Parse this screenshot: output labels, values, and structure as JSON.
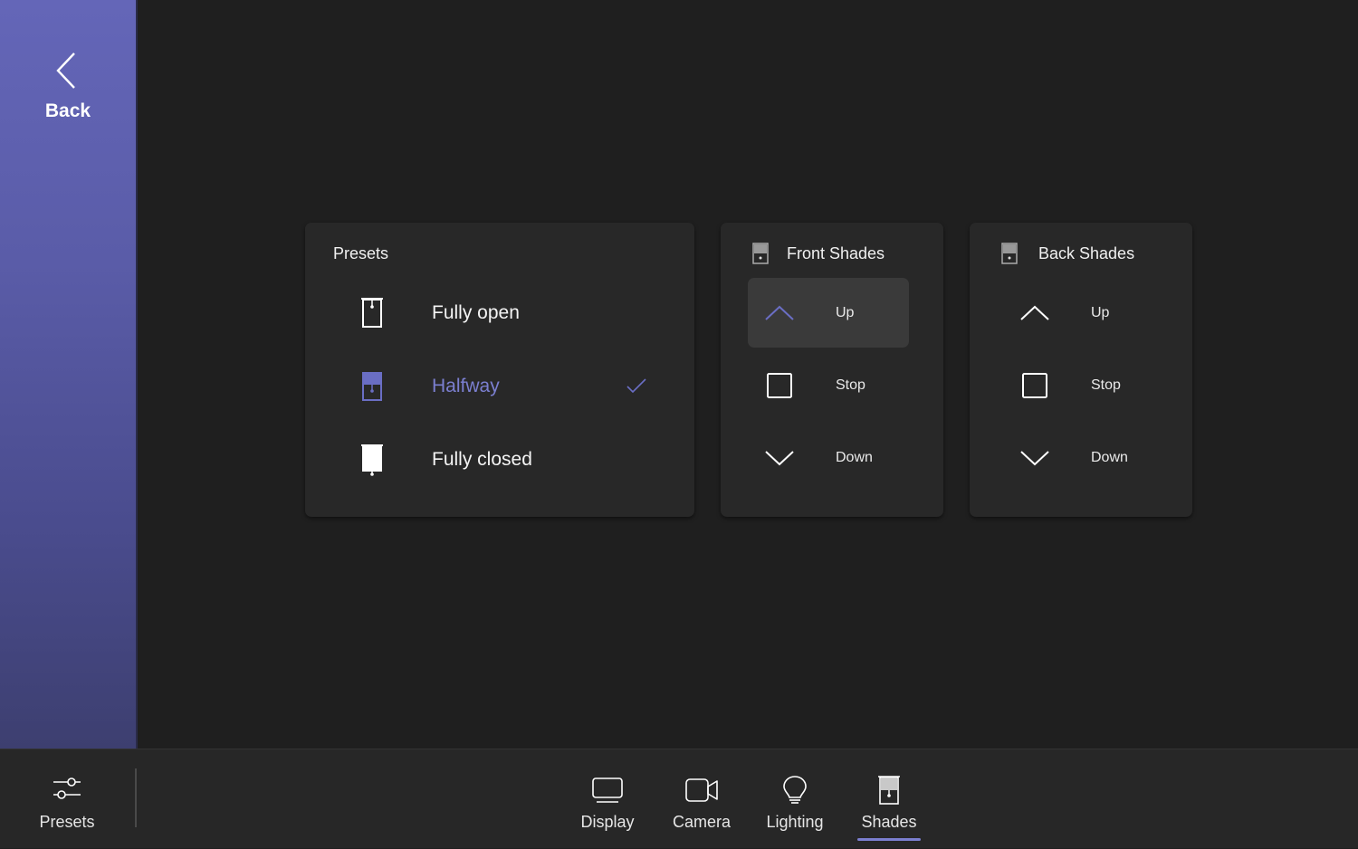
{
  "sidebar": {
    "back_label": "Back",
    "back_icon": "chevron-left-icon"
  },
  "colors": {
    "accent": "#7b7fd0",
    "sidebar_top": "#6466b8",
    "sidebar_bottom": "#3d3f70",
    "background": "#1f1f1f",
    "card": "#282828"
  },
  "presets_card": {
    "title": "Presets",
    "items": [
      {
        "label": "Fully open",
        "icon": "shade-open-icon",
        "selected": false
      },
      {
        "label": "Halfway",
        "icon": "shade-halfway-icon",
        "selected": true
      },
      {
        "label": "Fully closed",
        "icon": "shade-closed-icon",
        "selected": false
      }
    ]
  },
  "front_shades": {
    "title": "Front Shades",
    "icon": "shade-icon",
    "controls": [
      {
        "label": "Up",
        "icon": "chevron-up-icon",
        "active": true
      },
      {
        "label": "Stop",
        "icon": "stop-square-icon",
        "active": false
      },
      {
        "label": "Down",
        "icon": "chevron-down-icon",
        "active": false
      }
    ]
  },
  "back_shades": {
    "title": "Back Shades",
    "icon": "shade-icon",
    "controls": [
      {
        "label": "Up",
        "icon": "chevron-up-icon",
        "active": false
      },
      {
        "label": "Stop",
        "icon": "stop-square-icon",
        "active": false
      },
      {
        "label": "Down",
        "icon": "chevron-down-icon",
        "active": false
      }
    ]
  },
  "bottom_bar": {
    "presets_label": "Presets",
    "tabs": [
      {
        "label": "Display",
        "icon": "display-icon",
        "selected": false
      },
      {
        "label": "Camera",
        "icon": "camera-icon",
        "selected": false
      },
      {
        "label": "Lighting",
        "icon": "lightbulb-icon",
        "selected": false
      },
      {
        "label": "Shades",
        "icon": "shade-icon",
        "selected": true
      }
    ]
  }
}
